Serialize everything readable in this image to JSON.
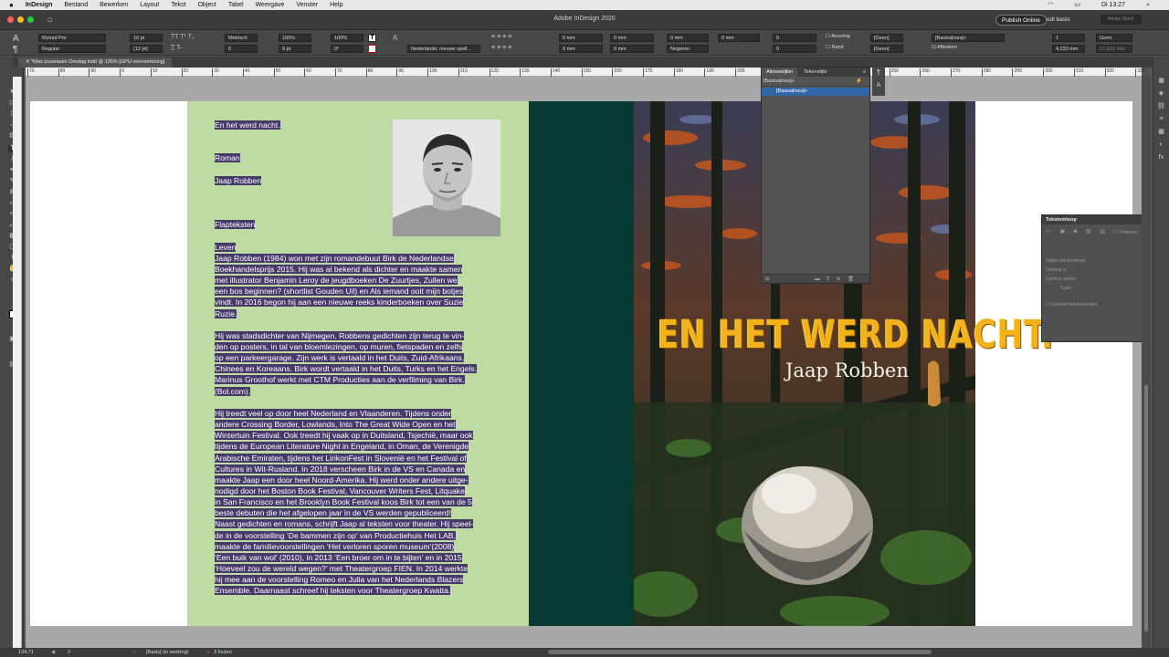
{
  "menubar": {
    "app": "InDesign",
    "items": [
      "Bestand",
      "Bewerken",
      "Layout",
      "Tekst",
      "Object",
      "Tabel",
      "Weergave",
      "Venster",
      "Help"
    ],
    "clock": "Di 13:27"
  },
  "titlebar": {
    "title": "Adobe InDesign 2020",
    "publish_label": "Publish Online",
    "workspace": "edi basis",
    "search_placeholder": "Adobe Stock"
  },
  "controlbar": {
    "font": "Myriad Pro",
    "style": "Regular",
    "size": "10 pt",
    "leading": "(12 pt)",
    "kerning": "Metrisch",
    "tracking": "0",
    "hscale": "100%",
    "vscale": "100%",
    "baseline": "0 pt",
    "skew": "0°",
    "language": "Nederlands: nieuwe spell...",
    "indent_left": "0 mm",
    "indent_right": "0 mm",
    "first_indent": "0 mm",
    "last_indent": "0 mm",
    "space_before": "0 mm",
    "space_after": "0 mm",
    "drop_lines": "0",
    "drop_chars": "0",
    "shading_label": "Arcering",
    "border_label": "Rand",
    "none_swatch": "[Geen]",
    "hyphenate_label": "Afbreken",
    "para_style": "[Basisalinea]+",
    "columns": "1",
    "gutter": "4,233 mm",
    "wrap_none": "Geen",
    "col_width": "17,332 mm",
    "align_label": "Negeren"
  },
  "document": {
    "tab": "*Klas jouwnaam Omslag.indd @ 135% [GPU-voorvertoning]",
    "ruler_marks": [
      "70",
      "80",
      "90",
      "0",
      "10",
      "20",
      "30",
      "40",
      "50",
      "60",
      "70",
      "80",
      "90",
      "100",
      "110",
      "120",
      "130",
      "140",
      "150",
      "160",
      "170",
      "180",
      "190",
      "200",
      "210",
      "220",
      "230",
      "240",
      "250",
      "260",
      "270",
      "280",
      "290",
      "300",
      "310",
      "320",
      "330"
    ]
  },
  "flap": {
    "lines": [
      "En het werd nacht.",
      "",
      "",
      "Roman",
      "",
      "Jaap Robben",
      "",
      "",
      "",
      "Flapteksten",
      "",
      "Leven",
      "Jaap Robben (1984) won met zijn romandebuut Birk de Nederlandse",
      "Boekhandelsprijs 2015. Hij was al bekend als dichter en maakte samen",
      "met illustrator Benjamin Leroy de jeugdboeken De Zuurtjes, Zullen we",
      "een bos beginnen? (shortlist Gouden Uil) en Als iemand ooit mijn botjes",
      "vindt. In 2016 begon hij aan een nieuwe reeks kinderboeken over Suzie",
      "Ruzie.",
      "",
      "Hij was stadsdichter van Nijmegen. Robbens gedichten zijn terug te vin-",
      "den op posters, in tal van bloemlezingen, op muren, fietspaden en zelfs",
      "op een parkeergarage. Zijn werk is vertaald in het Duits, Zuid-Afrikaans,",
      "Chinees en Koreaans. Birk wordt vertaald in het Duits, Turks en het Engels.",
      "Marinus Groothof werkt met CTM Producties aan de verfilming van Birk.",
      "(Bol.com).",
      "",
      "Hij treedt veel op door heel Nederland en Vlaanderen. Tijdens onder",
      "andere Crossing Border, Lowlands, Into The Great Wide Open en het",
      "Wintertuin Festival. Ook treedt hij vaak op in Duitsland, Tsjechië, maar ook",
      "tijdens de European Literature Night in Engeland, in Oman, de Verenigde",
      "Arabische Emiraten, tijdens het LirikonFest in Slovenië en het Festival of",
      "Cultures in Wit-Rusland. In 2018 verscheen Birk in de VS en Canada en",
      "maakte Jaap een door heel Noord-Amerika. Hij werd onder andere uitge-",
      "nodigd door het Boston Book Festival, Vancouver Writers Fest, Litquake",
      "in San Francisco en het Brooklyn Book Festival koos Birk tot een van de 5",
      "beste debuten die het afgelopen jaar in de VS werden gepubliceerd!",
      "Naast gedichten en romans, schrijft Jaap al teksten voor theater. Hij speel-",
      "de in de voorstelling ‘De bammen zijn op’ van Productiehuis Het LAB,",
      "maakte de familievoorstellingen ‘Het verloren sporen museum’(2008)",
      "‘Een buik van wol’ (2010), in 2013 ‘Een broer om in te bijten’ en in 2015",
      "‘Hoeveel zou de wereld wegen?’ met Theatergroep FIEN. In 2014 werkte",
      "hij mee aan de voorstelling Romeo en Julia van het Nederlands Blazers",
      "Ensemble. Daarnaast schreef hij teksten voor Theatergroep Kwatta."
    ]
  },
  "cover": {
    "title": "EN HET WERD NACHT.",
    "author": "Jaap Robben"
  },
  "paragraph_styles_panel": {
    "tab_active": "Alineastijlen",
    "tab_other": "Tekenstijle",
    "current": "[Basisalinea]+",
    "selected_item": "[Basisalinea]+"
  },
  "text_wrap_panel": {
    "title": "Tekstomloop",
    "invert_label": "Omkeren",
    "options_label": "Opties tekstomloop:",
    "wrap_to_label": "Omloop n.:",
    "contour_label": "Contour-opties:",
    "type_label": "Type:",
    "inner_edges_label": "Inclusief binnenranden"
  },
  "status": {
    "zoom": "134,71",
    "page": "2",
    "preflight_profile": "[Basis] (in werking)",
    "errors": "3 fouten"
  },
  "colors": {
    "flap_green": "#bedba4",
    "spine": "#063a32",
    "selection": "#473a6b",
    "title_yellow": "#f2b21b"
  }
}
